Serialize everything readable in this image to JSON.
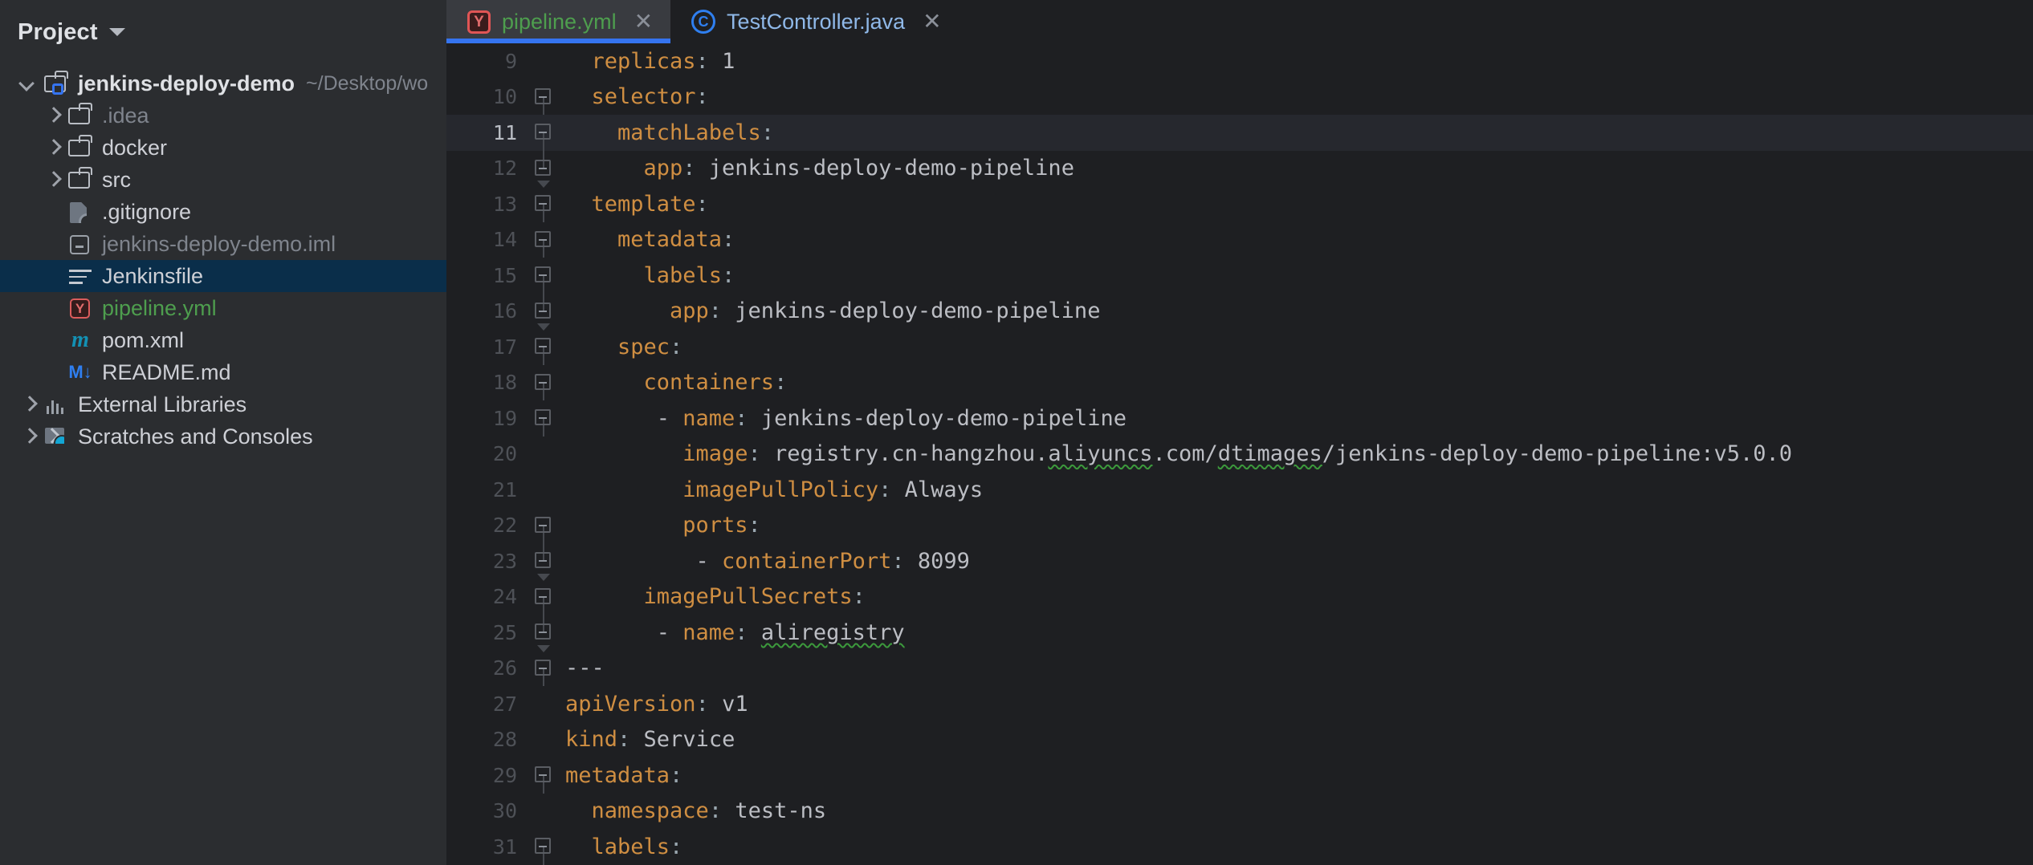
{
  "sidebar": {
    "title": "Project",
    "caret_icon": "chevron-down-icon",
    "tree": [
      {
        "label": "jenkins-deploy-demo",
        "path_hint": "~/Desktop/wo",
        "icon": "folder-module-icon",
        "arrow": "expanded",
        "depth": 1,
        "style": "bold",
        "selected": false
      },
      {
        "label": ".idea",
        "path_hint": "",
        "icon": "folder-icon",
        "arrow": "collapsed",
        "depth": 2,
        "style": "dim",
        "selected": false
      },
      {
        "label": "docker",
        "path_hint": "",
        "icon": "folder-icon",
        "arrow": "collapsed",
        "depth": 2,
        "style": "normal",
        "selected": false
      },
      {
        "label": "src",
        "path_hint": "",
        "icon": "folder-icon",
        "arrow": "collapsed",
        "depth": 2,
        "style": "normal",
        "selected": false
      },
      {
        "label": ".gitignore",
        "path_hint": "",
        "icon": "gitignore-file-icon",
        "arrow": "none",
        "depth": 2,
        "style": "normal",
        "selected": false
      },
      {
        "label": "jenkins-deploy-demo.iml",
        "path_hint": "",
        "icon": "iml-file-icon",
        "arrow": "none",
        "depth": 2,
        "style": "dim",
        "selected": false
      },
      {
        "label": "Jenkinsfile",
        "path_hint": "",
        "icon": "text-file-icon",
        "arrow": "none",
        "depth": 2,
        "style": "normal",
        "selected": true
      },
      {
        "label": "pipeline.yml",
        "path_hint": "",
        "icon": "yaml-file-icon",
        "arrow": "none",
        "depth": 2,
        "style": "green",
        "selected": false
      },
      {
        "label": "pom.xml",
        "path_hint": "",
        "icon": "maven-file-icon",
        "arrow": "none",
        "depth": 2,
        "style": "normal",
        "selected": false
      },
      {
        "label": "README.md",
        "path_hint": "",
        "icon": "markdown-file-icon",
        "arrow": "none",
        "depth": 2,
        "style": "normal",
        "selected": false
      },
      {
        "label": "External Libraries",
        "path_hint": "",
        "icon": "libraries-icon",
        "arrow": "collapsed",
        "depth": 1,
        "style": "normal",
        "selected": false
      },
      {
        "label": "Scratches and Consoles",
        "path_hint": "",
        "icon": "scratches-icon",
        "arrow": "collapsed",
        "depth": 1,
        "style": "normal",
        "selected": false
      }
    ]
  },
  "tabs": [
    {
      "label": "pipeline.yml",
      "icon": "yaml-file-icon",
      "icon_glyph": "Y",
      "close_glyph": "✕",
      "active": true,
      "kind": "yml"
    },
    {
      "label": "TestController.java",
      "icon": "java-class-icon",
      "icon_glyph": "C",
      "close_glyph": "✕",
      "active": false,
      "kind": "java"
    }
  ],
  "editor": {
    "current_line": 11,
    "colors": {
      "key": "#cf8e42",
      "value": "#bcbec4",
      "gutter": "#4e5157",
      "background": "#1e1f22",
      "current_line_bg": "#26282e",
      "typo_underline": "#3c9a3c"
    },
    "lines": [
      {
        "n": 9,
        "fold": "none",
        "indent": 2,
        "segments": [
          {
            "t": "replicas",
            "c": "k"
          },
          {
            "t": ": ",
            "c": "colon"
          },
          {
            "t": "1",
            "c": "v"
          }
        ]
      },
      {
        "n": 10,
        "fold": "start",
        "indent": 2,
        "segments": [
          {
            "t": "selector",
            "c": "k"
          },
          {
            "t": ":",
            "c": "colon"
          }
        ]
      },
      {
        "n": 11,
        "fold": "start",
        "indent": 4,
        "segments": [
          {
            "t": "matchLabels",
            "c": "k"
          },
          {
            "t": ":",
            "c": "colon"
          }
        ]
      },
      {
        "n": 12,
        "fold": "end",
        "indent": 6,
        "segments": [
          {
            "t": "app",
            "c": "k"
          },
          {
            "t": ": ",
            "c": "colon"
          },
          {
            "t": "jenkins-deploy-demo-pipeline",
            "c": "v"
          }
        ]
      },
      {
        "n": 13,
        "fold": "start",
        "indent": 2,
        "segments": [
          {
            "t": "template",
            "c": "k"
          },
          {
            "t": ":",
            "c": "colon"
          }
        ]
      },
      {
        "n": 14,
        "fold": "start",
        "indent": 4,
        "segments": [
          {
            "t": "metadata",
            "c": "k"
          },
          {
            "t": ":",
            "c": "colon"
          }
        ]
      },
      {
        "n": 15,
        "fold": "start",
        "indent": 6,
        "segments": [
          {
            "t": "labels",
            "c": "k"
          },
          {
            "t": ":",
            "c": "colon"
          }
        ]
      },
      {
        "n": 16,
        "fold": "end",
        "indent": 8,
        "segments": [
          {
            "t": "app",
            "c": "k"
          },
          {
            "t": ": ",
            "c": "colon"
          },
          {
            "t": "jenkins-deploy-demo-pipeline",
            "c": "v"
          }
        ]
      },
      {
        "n": 17,
        "fold": "start",
        "indent": 4,
        "segments": [
          {
            "t": "spec",
            "c": "k"
          },
          {
            "t": ":",
            "c": "colon"
          }
        ]
      },
      {
        "n": 18,
        "fold": "start",
        "indent": 6,
        "segments": [
          {
            "t": "containers",
            "c": "k"
          },
          {
            "t": ":",
            "c": "colon"
          }
        ]
      },
      {
        "n": 19,
        "fold": "start",
        "indent": 7,
        "segments": [
          {
            "t": "- ",
            "c": "v"
          },
          {
            "t": "name",
            "c": "k"
          },
          {
            "t": ": ",
            "c": "colon"
          },
          {
            "t": "jenkins-deploy-demo-pipeline",
            "c": "v"
          }
        ]
      },
      {
        "n": 20,
        "fold": "none",
        "indent": 9,
        "segments": [
          {
            "t": "image",
            "c": "k"
          },
          {
            "t": ": ",
            "c": "colon"
          },
          {
            "t": "registry.cn-hangzhou.",
            "c": "v"
          },
          {
            "t": "aliyuncs",
            "c": "sq"
          },
          {
            "t": ".com/",
            "c": "v"
          },
          {
            "t": "dtimages",
            "c": "sq"
          },
          {
            "t": "/jenkins-deploy-demo-pipeline:v5.0.0",
            "c": "v"
          }
        ]
      },
      {
        "n": 21,
        "fold": "none",
        "indent": 9,
        "segments": [
          {
            "t": "imagePullPolicy",
            "c": "k"
          },
          {
            "t": ": ",
            "c": "colon"
          },
          {
            "t": "Always",
            "c": "v"
          }
        ]
      },
      {
        "n": 22,
        "fold": "start",
        "indent": 9,
        "segments": [
          {
            "t": "ports",
            "c": "k"
          },
          {
            "t": ":",
            "c": "colon"
          }
        ]
      },
      {
        "n": 23,
        "fold": "end",
        "indent": 10,
        "segments": [
          {
            "t": "- ",
            "c": "v"
          },
          {
            "t": "containerPort",
            "c": "k"
          },
          {
            "t": ": ",
            "c": "colon"
          },
          {
            "t": "8099",
            "c": "v"
          }
        ]
      },
      {
        "n": 24,
        "fold": "start",
        "indent": 6,
        "segments": [
          {
            "t": "imagePullSecrets",
            "c": "k"
          },
          {
            "t": ":",
            "c": "colon"
          }
        ]
      },
      {
        "n": 25,
        "fold": "end",
        "indent": 7,
        "segments": [
          {
            "t": "- ",
            "c": "v"
          },
          {
            "t": "name",
            "c": "k"
          },
          {
            "t": ": ",
            "c": "colon"
          },
          {
            "t": "aliregistry",
            "c": "sq"
          }
        ]
      },
      {
        "n": 26,
        "fold": "start",
        "indent": 0,
        "segments": [
          {
            "t": "---",
            "c": "v"
          }
        ]
      },
      {
        "n": 27,
        "fold": "none",
        "indent": 0,
        "segments": [
          {
            "t": "apiVersion",
            "c": "k"
          },
          {
            "t": ": ",
            "c": "colon"
          },
          {
            "t": "v1",
            "c": "v"
          }
        ]
      },
      {
        "n": 28,
        "fold": "none",
        "indent": 0,
        "segments": [
          {
            "t": "kind",
            "c": "k"
          },
          {
            "t": ": ",
            "c": "colon"
          },
          {
            "t": "Service",
            "c": "v"
          }
        ]
      },
      {
        "n": 29,
        "fold": "start",
        "indent": 0,
        "segments": [
          {
            "t": "metadata",
            "c": "k"
          },
          {
            "t": ":",
            "c": "colon"
          }
        ]
      },
      {
        "n": 30,
        "fold": "none",
        "indent": 2,
        "segments": [
          {
            "t": "namespace",
            "c": "k"
          },
          {
            "t": ": ",
            "c": "colon"
          },
          {
            "t": "test-ns",
            "c": "v"
          }
        ]
      },
      {
        "n": 31,
        "fold": "start",
        "indent": 2,
        "segments": [
          {
            "t": "labels",
            "c": "k"
          },
          {
            "t": ":",
            "c": "colon"
          }
        ]
      }
    ]
  }
}
